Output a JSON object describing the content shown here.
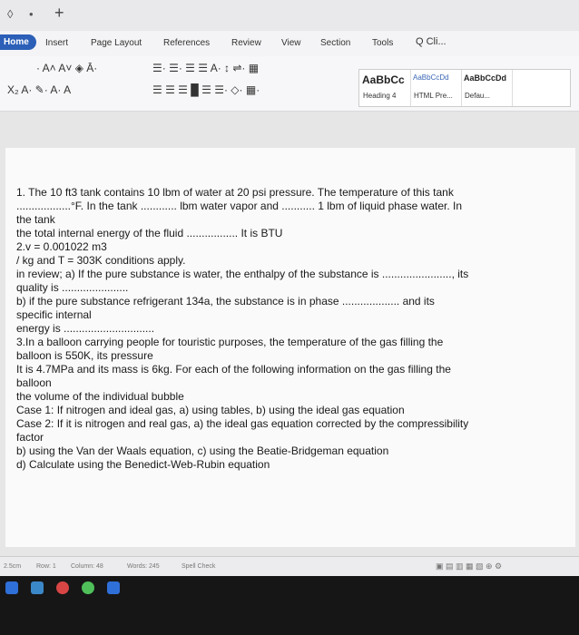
{
  "menu": {
    "tabs": [
      "Home",
      "Insert",
      "Page Layout",
      "References",
      "Review",
      "View",
      "Section",
      "Tools"
    ],
    "search": "Q Cli..."
  },
  "ribbon": {
    "styles": [
      {
        "preview": "AaBbCc",
        "name": "Heading 4"
      },
      {
        "preview": "AaBbCcDd",
        "name": "HTML Pre..."
      },
      {
        "preview": "AaBbCcDd",
        "name": "Defau..."
      }
    ]
  },
  "document": {
    "lines": [
      "1. The 10 ft3 tank contains 10 lbm of water at 20 psi pressure. The temperature of this tank",
      "..................°F. In the tank ............ lbm water vapor and ........... 1 lbm of liquid phase water. In",
      "the tank",
      "the total internal energy of the fluid ................. It is BTU",
      "2.v = 0.001022 m3",
      "/ kg and T = 303K conditions apply.",
      "in review; a) If the pure substance is water, the enthalpy of the substance is ......................., its",
      "quality is ......................",
      "b) if the pure substance refrigerant 134a, the substance is in phase ................... and its",
      "specific internal",
      "energy is ..............................",
      "3.In a balloon carrying people for touristic purposes, the temperature of the gas filling the",
      "balloon is 550K, its pressure",
      "It is 4.7MPa and its mass is 6kg. For each of the following information on the gas filling the",
      "balloon",
      "the volume of the individual bubble",
      "Case 1: If nitrogen and ideal gas, a) using tables, b) using the ideal gas equation",
      "Case 2: If it is nitrogen and real gas, a) the ideal gas equation corrected by the compressibility",
      "factor",
      "b) using the Van der Waals equation, c) using the Beatie-Bridgeman equation",
      "d) Calculate using the Benedict-Web-Rubin equation"
    ]
  },
  "status": {
    "position": "2.5cm",
    "row": "Row: 1",
    "column": "Column: 48",
    "words": "Words: 245",
    "spell": "Spell Check"
  }
}
